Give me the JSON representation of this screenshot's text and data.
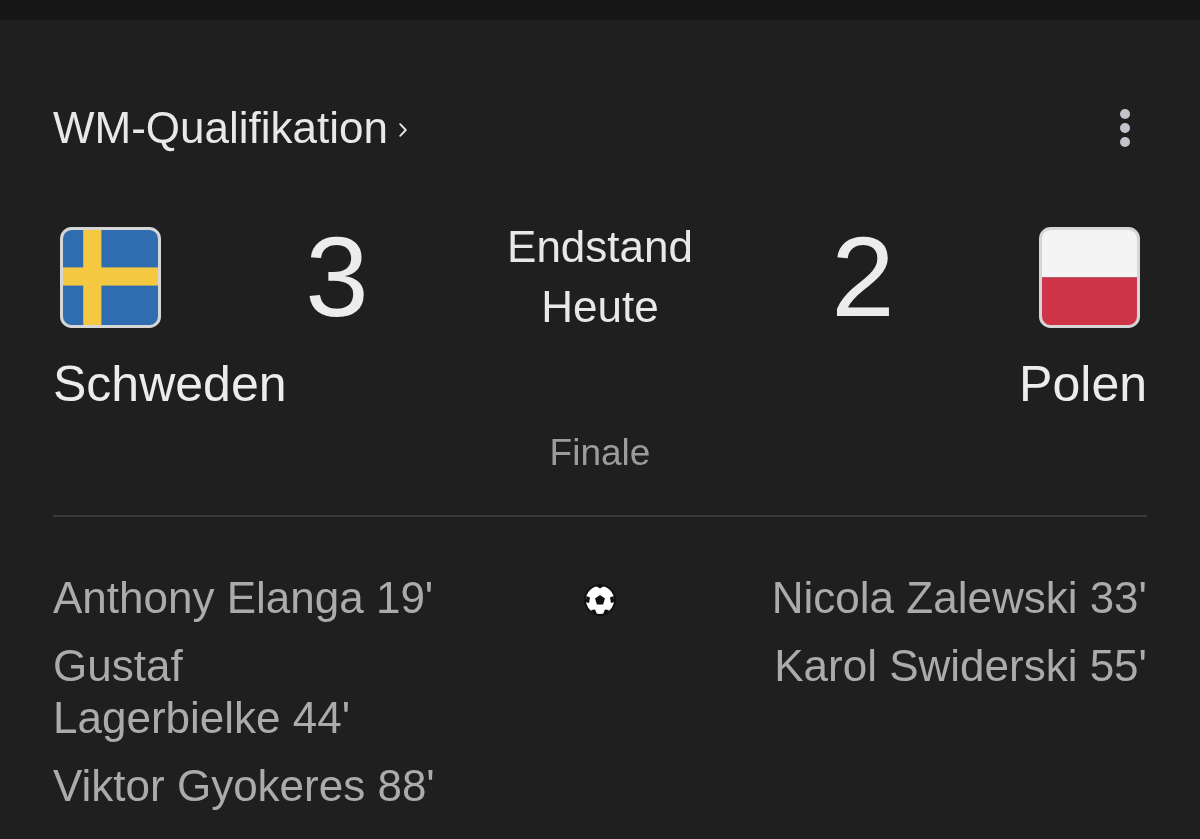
{
  "header": {
    "title": "WM-Qualifikation"
  },
  "match": {
    "status": "Endstand",
    "date": "Heute",
    "stage": "Finale"
  },
  "teams": [
    {
      "name": "Schweden",
      "score": "3",
      "kind": "sweden",
      "goals": [
        "Anthony Elanga 19'",
        "Gustaf Lagerbielke 44'",
        "Viktor Gyokeres 88'"
      ]
    },
    {
      "name": "Polen",
      "score": "2",
      "kind": "poland",
      "goals": [
        "Nicola Zalewski 33'",
        "Karol Swiderski 55'"
      ]
    }
  ]
}
